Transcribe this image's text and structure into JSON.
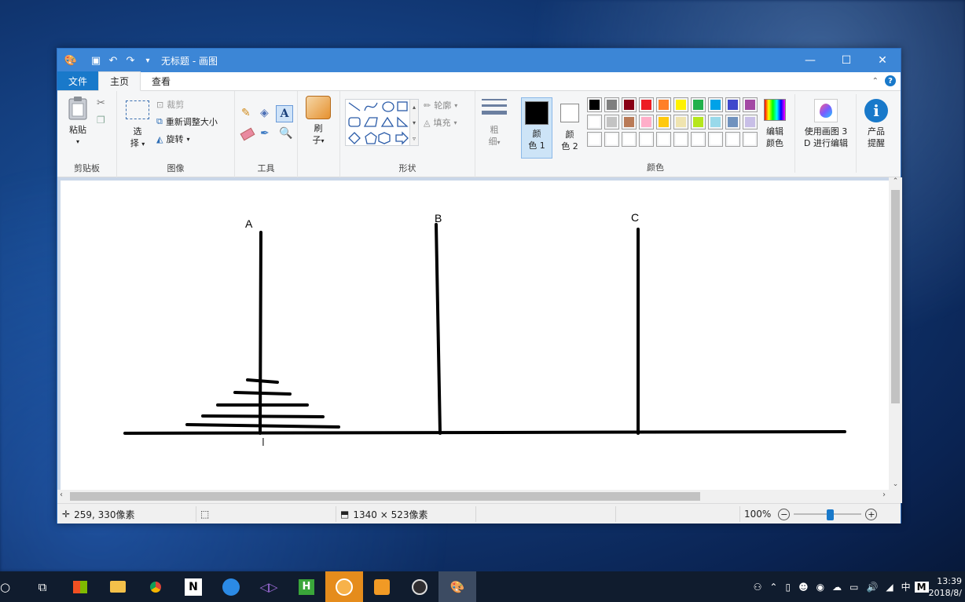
{
  "window": {
    "title": "无标题 - 画图",
    "buttons": {
      "minimize": "—",
      "maximize": "☐",
      "close": "✕"
    }
  },
  "tabs": {
    "file": "文件",
    "home": "主页",
    "view": "查看"
  },
  "ribbon": {
    "clipboard": {
      "paste": "粘贴",
      "group": "剪贴板"
    },
    "image": {
      "select": "选",
      "select2": "择",
      "crop": "裁剪",
      "resize": "重新调整大小",
      "rotate": "旋转",
      "group": "图像"
    },
    "tools": {
      "group": "工具"
    },
    "brushes": {
      "label": "刷",
      "label2": "子"
    },
    "shapes": {
      "outline": "轮廓",
      "fill": "填充",
      "group": "形状"
    },
    "size": {
      "label": "粗",
      "label2": "细"
    },
    "color1": {
      "label": "颜",
      "label2": "色 1"
    },
    "color2": {
      "label": "颜",
      "label2": "色 2"
    },
    "palette_group": "颜色",
    "edit_colors": {
      "label": "编辑",
      "label2": "颜色"
    },
    "paint3d": {
      "label": "使用画图 3",
      "label2": "D 进行编辑"
    },
    "product": {
      "label": "产品",
      "label2": "提醒"
    },
    "palette": [
      "#000000",
      "#7f7f7f",
      "#880015",
      "#ed1c24",
      "#ff7f27",
      "#fff200",
      "#22b14c",
      "#00a2e8",
      "#3f48cc",
      "#a349a4",
      "#ffffff",
      "#c3c3c3",
      "#b97a57",
      "#ffaec9",
      "#ffc90e",
      "#efe4b0",
      "#b5e61d",
      "#99d9ea",
      "#7092be",
      "#c8bfe7"
    ]
  },
  "canvas": {
    "labels": {
      "a": "A",
      "b": "B",
      "c": "C"
    }
  },
  "status": {
    "cursor_pos": "259, 330像素",
    "image_size": "1340 × 523像素",
    "zoom": "100%",
    "zoom_fraction": 0.55
  },
  "taskbar": {
    "time": "13:39",
    "date": "2018/8/",
    "ime": "中",
    "ime2": "M"
  }
}
